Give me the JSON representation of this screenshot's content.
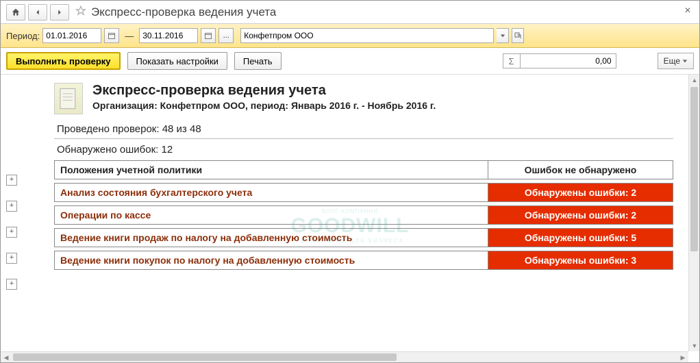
{
  "window": {
    "title": "Экспресс-проверка ведения учета"
  },
  "period": {
    "label": "Период:",
    "from": "01.01.2016",
    "to": "30.11.2016",
    "dash": "—",
    "ellipsis": "...",
    "org": "Конфетпром ООО"
  },
  "toolbar": {
    "run": "Выполнить проверку",
    "settings": "Показать настройки",
    "print": "Печать",
    "sum_value": "0,00",
    "more": "Еще"
  },
  "report": {
    "title": "Экспресс-проверка ведения учета",
    "subtitle": "Организация: Конфетпром ООО, период: Январь 2016 г. - Ноябрь 2016 г.",
    "checks_done": "Проведено проверок: 48 из 48",
    "errors_found": "Обнаружено ошибок: 12",
    "header_cat": "Положения учетной политики",
    "header_status": "Ошибок не обнаружено",
    "rows": [
      {
        "name": "Анализ состояния бухгалтерского учета",
        "status": "Обнаружены ошибки: 2",
        "error": true
      },
      {
        "name": "Операции по кассе",
        "status": "Обнаружены ошибки: 2",
        "error": true
      },
      {
        "name": "Ведение книги продаж по налогу на добавленную стоимость",
        "status": "Обнаружены ошибки: 5",
        "error": true
      },
      {
        "name": "Ведение книги покупок по налогу на добавленную стоимость",
        "status": "Обнаружены ошибки: 3",
        "error": true
      }
    ]
  },
  "watermark": {
    "top": "БЛОГ КОМПАНИИ",
    "main": "GOODWILL",
    "bot": "ТЕХНОЛОГИИ ДЛЯ БИЗНЕСА"
  }
}
